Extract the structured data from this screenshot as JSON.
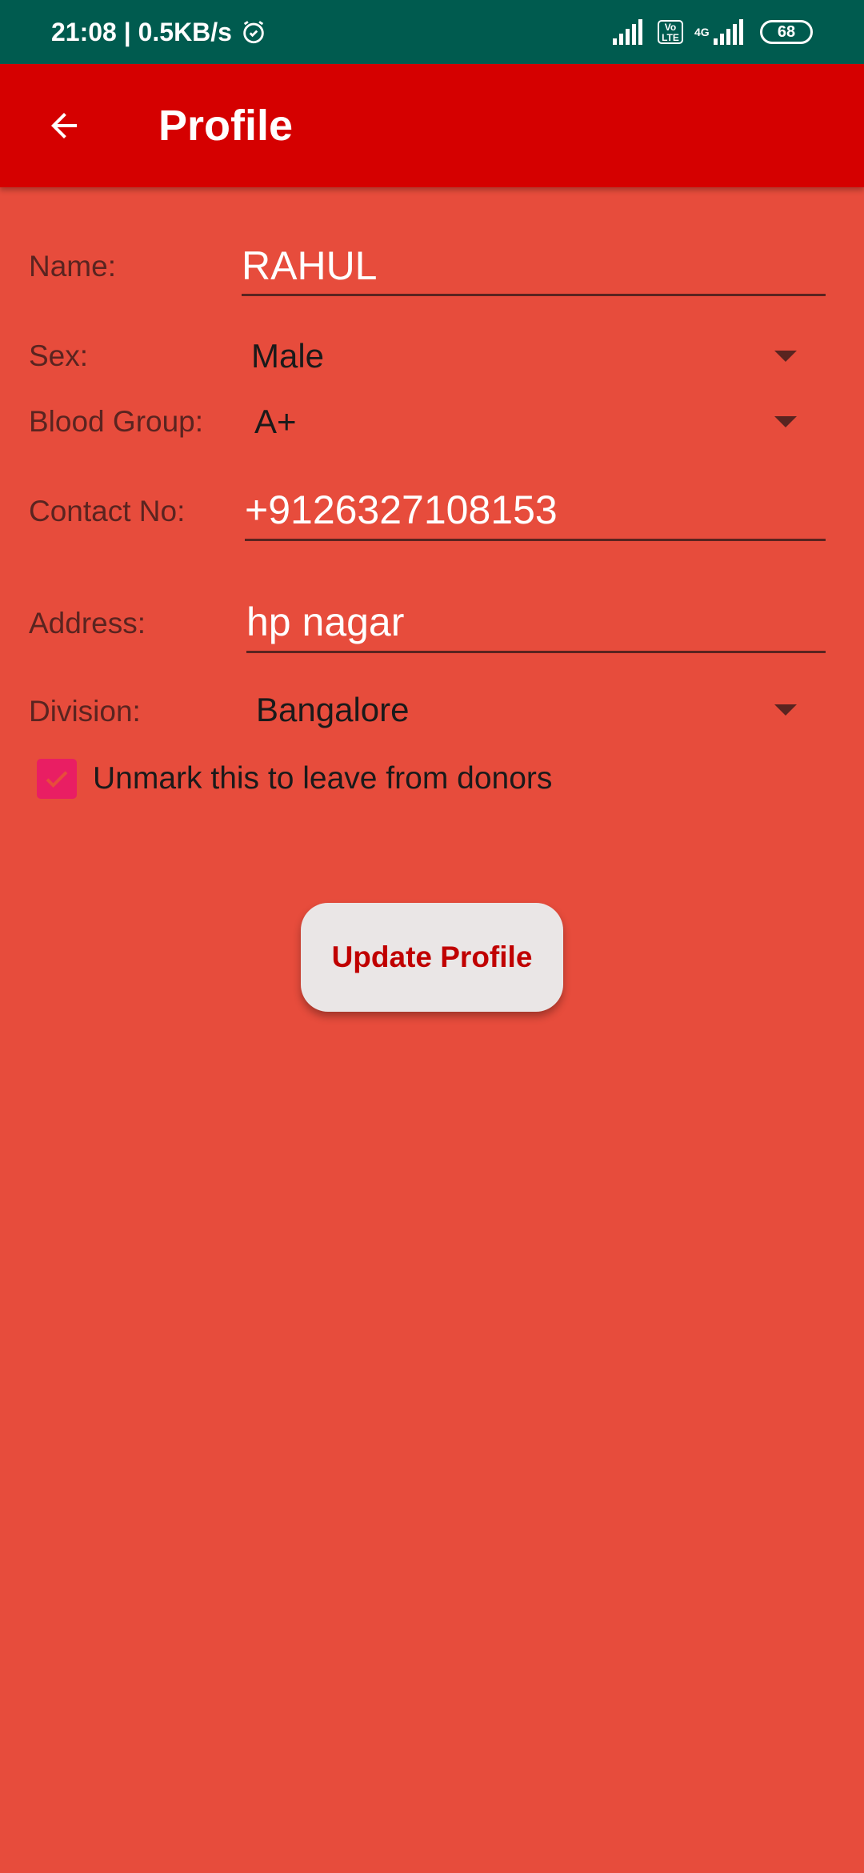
{
  "status_bar": {
    "time_speed": "21:08 | 0.5KB/s",
    "volte_line1": "Vo",
    "volte_line2": "LTE",
    "network": "4G",
    "battery": "68"
  },
  "app_bar": {
    "title": "Profile"
  },
  "form": {
    "name_label": "Name:",
    "name_value": "RAHUL",
    "sex_label": "Sex:",
    "sex_value": "Male",
    "blood_group_label": "Blood Group:",
    "blood_group_value": "A+",
    "contact_label": "Contact No:",
    "contact_value": "+9126327108153",
    "address_label": "Address:",
    "address_value": "hp nagar",
    "division_label": "Division:",
    "division_value": "Bangalore",
    "donor_checkbox_label": "Unmark this to leave from donors",
    "donor_checked": true,
    "update_button": "Update Profile"
  },
  "colors": {
    "status_bar": "#005B4F",
    "app_bar": "#D50000",
    "background": "#E74C3C",
    "checkbox": "#E91E63",
    "button_text": "#C00000"
  }
}
